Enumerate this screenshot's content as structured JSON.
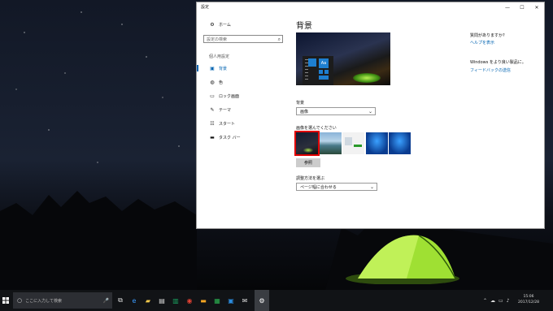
{
  "window": {
    "title": "設定",
    "controls": [
      "—",
      "☐",
      "✕"
    ]
  },
  "sidebar": {
    "home_label": "ホーム",
    "search_placeholder": "設定の検索",
    "section_label": "個人用設定",
    "items": [
      {
        "label": "背景",
        "icon": "picture-icon"
      },
      {
        "label": "色",
        "icon": "palette-icon"
      },
      {
        "label": "ロック画面",
        "icon": "lock-screen-icon"
      },
      {
        "label": "テーマ",
        "icon": "brush-icon"
      },
      {
        "label": "スタート",
        "icon": "start-icon"
      },
      {
        "label": "タスク バー",
        "icon": "taskbar-icon"
      }
    ]
  },
  "main": {
    "title": "背景",
    "preview_tile_label": "Aa",
    "background_label": "背景",
    "background_value": "画像",
    "choose_image_label": "画像を選んでください",
    "browse_label": "参照",
    "fit_label": "調整方法を選ぶ",
    "fit_value": "ページ幅に合わせる"
  },
  "help": {
    "question": "質問がありますか?",
    "help_link": "ヘルプを表示",
    "improve": "Windows をより良い製品に。",
    "feedback_link": "フィードバックの送信"
  },
  "taskbar": {
    "search_placeholder": "ここに入力して検索",
    "time": "15:06",
    "date": "2017/12/28"
  },
  "colors": {
    "accent": "#0063b1",
    "selection": "#e00000",
    "taskbar": "#111316"
  }
}
